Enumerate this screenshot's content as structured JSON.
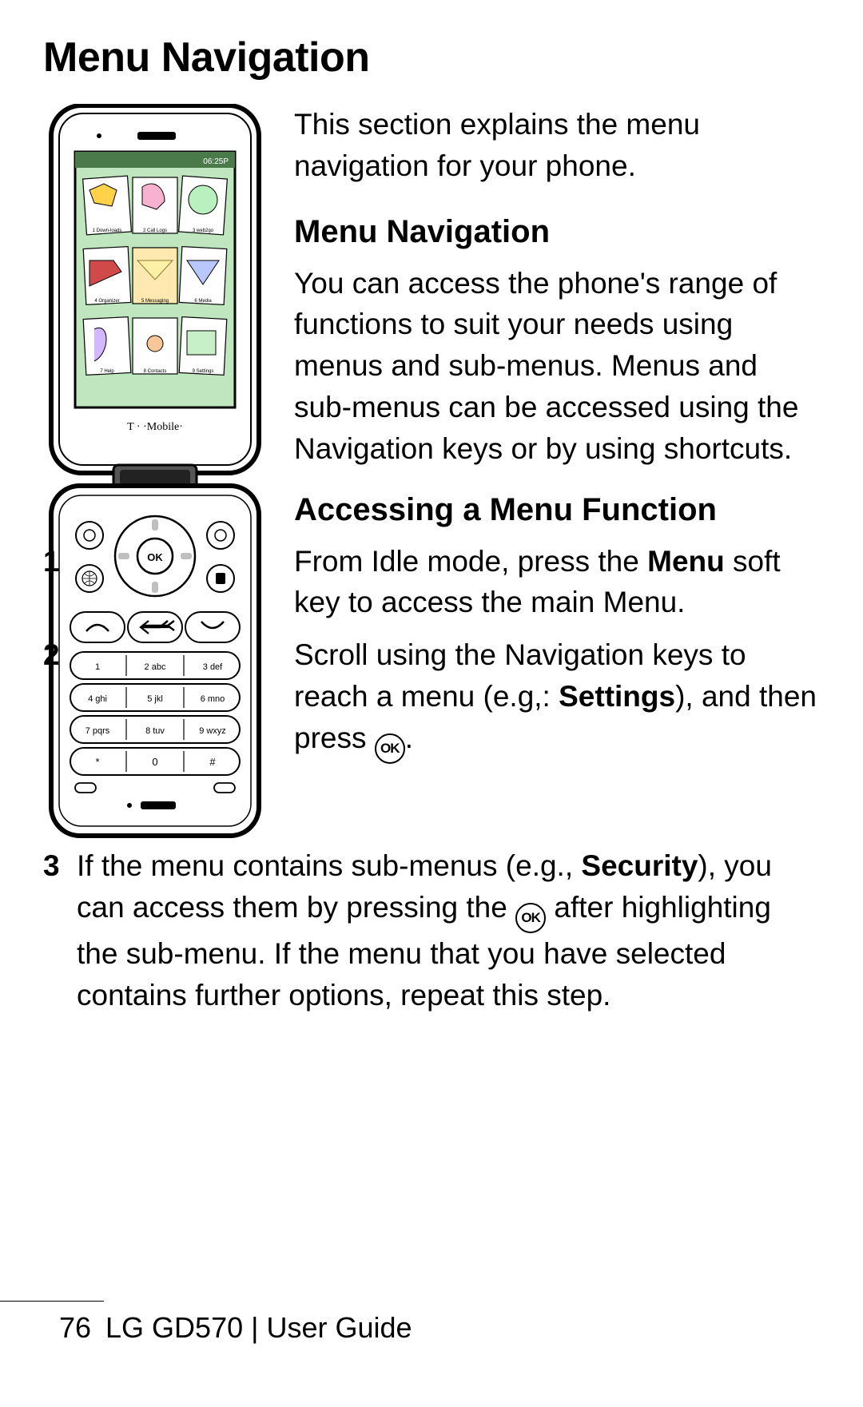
{
  "page_title": "Menu Navigation",
  "intro": "This section explains the menu navigation for your phone.",
  "section1": {
    "heading": "Menu Navigation",
    "paragraph": "You can access the phone's range of functions to suit your needs using menus and sub-menus. Menus and sub-menus can be accessed using the Navigation keys or by using shortcuts."
  },
  "section2": {
    "heading": "Accessing a Menu Function",
    "steps": {
      "s1_a": "From Idle mode, press the ",
      "s1_bold": "Menu",
      "s1_b": " soft key to access the main Menu.",
      "s2_a": "Scroll using the Navigation keys to reach a menu (e.g,: ",
      "s2_bold": "Settings",
      "s2_b": "), and then press ",
      "s2_c": ".",
      "s3_a": "If the menu contains sub-menus (e.g., ",
      "s3_bold": "Security",
      "s3_b": "), you can access them by pressing the ",
      "s3_c": " after highlighting the sub-menu. If the menu that you have selected contains further options, repeat this step."
    }
  },
  "ok_label": "OK",
  "footer": {
    "page_number": "76",
    "product": "LG GD570",
    "divider": "  |  ",
    "doc_name": "User Guide"
  },
  "phone": {
    "carrier": "T · ·Mobile·",
    "time": "06:25P",
    "screen_cells": [
      "1 Down-loads",
      "2 Call Logs",
      "3 web2go",
      "4 Organizer",
      "5 Messaging",
      "6 Media",
      "7 Help",
      "8 Contacts",
      "9 Settings"
    ],
    "keys_row1": [
      "1",
      "2 abc",
      "3 def"
    ],
    "keys_row2": [
      "4 ghi",
      "5 jkl",
      "6 mno"
    ],
    "keys_row3": [
      "7 pqrs",
      "8 tuv",
      "9 wxyz"
    ],
    "keys_row4": [
      "*",
      "0",
      "#"
    ]
  }
}
